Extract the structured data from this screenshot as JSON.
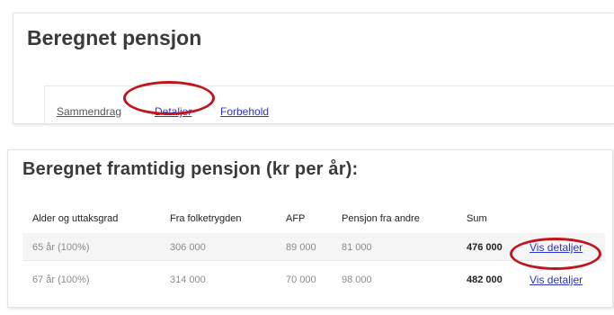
{
  "page": {
    "title": "Beregnet pensjon",
    "tabs": [
      {
        "label": "Sammendrag"
      },
      {
        "label": "Detaljer"
      },
      {
        "label": "Forbehold"
      }
    ]
  },
  "table": {
    "title": "Beregnet framtidig pensjon (kr per år):",
    "headers": [
      "Alder og uttaksgrad",
      "Fra folketrygden",
      "AFP",
      "Pensjon fra andre",
      "Sum"
    ],
    "rows": [
      {
        "age": "65 år (100%)",
        "folketrygd": "306 000",
        "afp": "89 000",
        "andre": "81 000",
        "sum": "476 000",
        "link": "Vis detaljer"
      },
      {
        "age": "67 år (100%)",
        "folketrygd": "314 000",
        "afp": "70 000",
        "andre": "98 000",
        "sum": "482 000",
        "link": "Vis detaljer"
      }
    ]
  },
  "colors": {
    "link": "#2a36c8",
    "highlight_ring": "#c1151c"
  }
}
